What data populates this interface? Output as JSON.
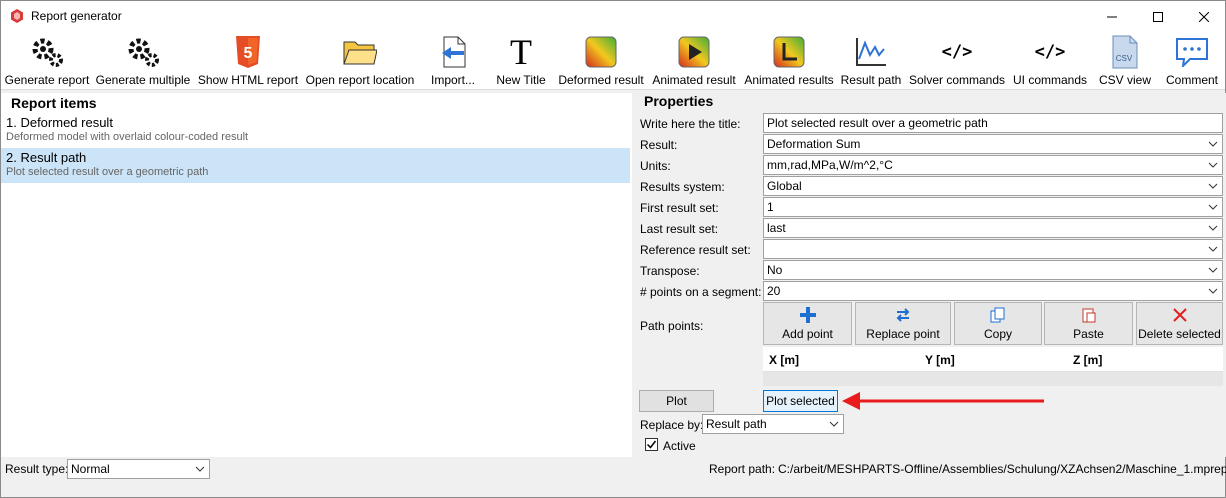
{
  "window": {
    "title": "Report generator"
  },
  "toolbar": {
    "items": [
      {
        "label": "Generate report",
        "icon": "gears-icon"
      },
      {
        "label": "Generate multiple",
        "icon": "gears-icon"
      },
      {
        "label": "Show HTML report",
        "icon": "html5-icon"
      },
      {
        "label": "Open report location",
        "icon": "folder-icon"
      },
      {
        "label": "Import...",
        "icon": "import-icon"
      },
      {
        "label": "New Title",
        "icon": "title-icon"
      },
      {
        "label": "Deformed result",
        "icon": "deformed-result-icon"
      },
      {
        "label": "Animated result",
        "icon": "animated-result-icon"
      },
      {
        "label": "Animated results",
        "icon": "animated-results-icon"
      },
      {
        "label": "Result path",
        "icon": "result-path-icon"
      },
      {
        "label": "Solver commands",
        "icon": "code-icon"
      },
      {
        "label": "UI commands",
        "icon": "code-icon"
      },
      {
        "label": "CSV view",
        "icon": "csv-icon"
      },
      {
        "label": "Comment",
        "icon": "comment-icon"
      }
    ]
  },
  "report_items": {
    "header": "Report items",
    "items": [
      {
        "title": "1. Deformed result",
        "desc": "Deformed model with overlaid colour-coded result",
        "selected": false
      },
      {
        "title": "2. Result path",
        "desc": "Plot selected result over a geometric path",
        "selected": true
      }
    ]
  },
  "properties": {
    "header": "Properties",
    "title_label": "Write here the title:",
    "title_value": "Plot selected result over a geometric path",
    "result_label": "Result:",
    "result_value": "Deformation Sum",
    "units_label": "Units:",
    "units_value": "mm,rad,MPa,W/m^2,°C",
    "system_label": "Results system:",
    "system_value": "Global",
    "first_label": "First result set:",
    "first_value": "1",
    "last_label": "Last result set:",
    "last_value": "last",
    "ref_label": "Reference result set:",
    "ref_value": "",
    "transpose_label": "Transpose:",
    "transpose_value": "No",
    "points_label": "# points on a segment:",
    "points_value": "20",
    "path_points_label": "Path points:",
    "path_buttons": {
      "add": "Add point",
      "replace": "Replace point",
      "copy": "Copy",
      "paste": "Paste",
      "delete": "Delete selected"
    },
    "columns": {
      "x": "X [m]",
      "y": "Y [m]",
      "z": "Z [m]"
    },
    "plot_label": "Plot",
    "plot_selected_label": "Plot selected",
    "replace_by_label": "Replace by:",
    "replace_by_value": "Result path",
    "active_label": "Active",
    "active_checked": true
  },
  "bottom": {
    "result_type_label": "Result type:",
    "result_type_value": "Normal",
    "report_path_label": "Report path:",
    "report_path_value": "C:/arbeit/MESHPARTS-Offline/Assemblies/Schulung/XZAchsen2/Maschine_1.mprep"
  },
  "colors": {
    "selection": "#cce4f7",
    "arrow": "#e81c1c",
    "accent": "#0078d7"
  }
}
